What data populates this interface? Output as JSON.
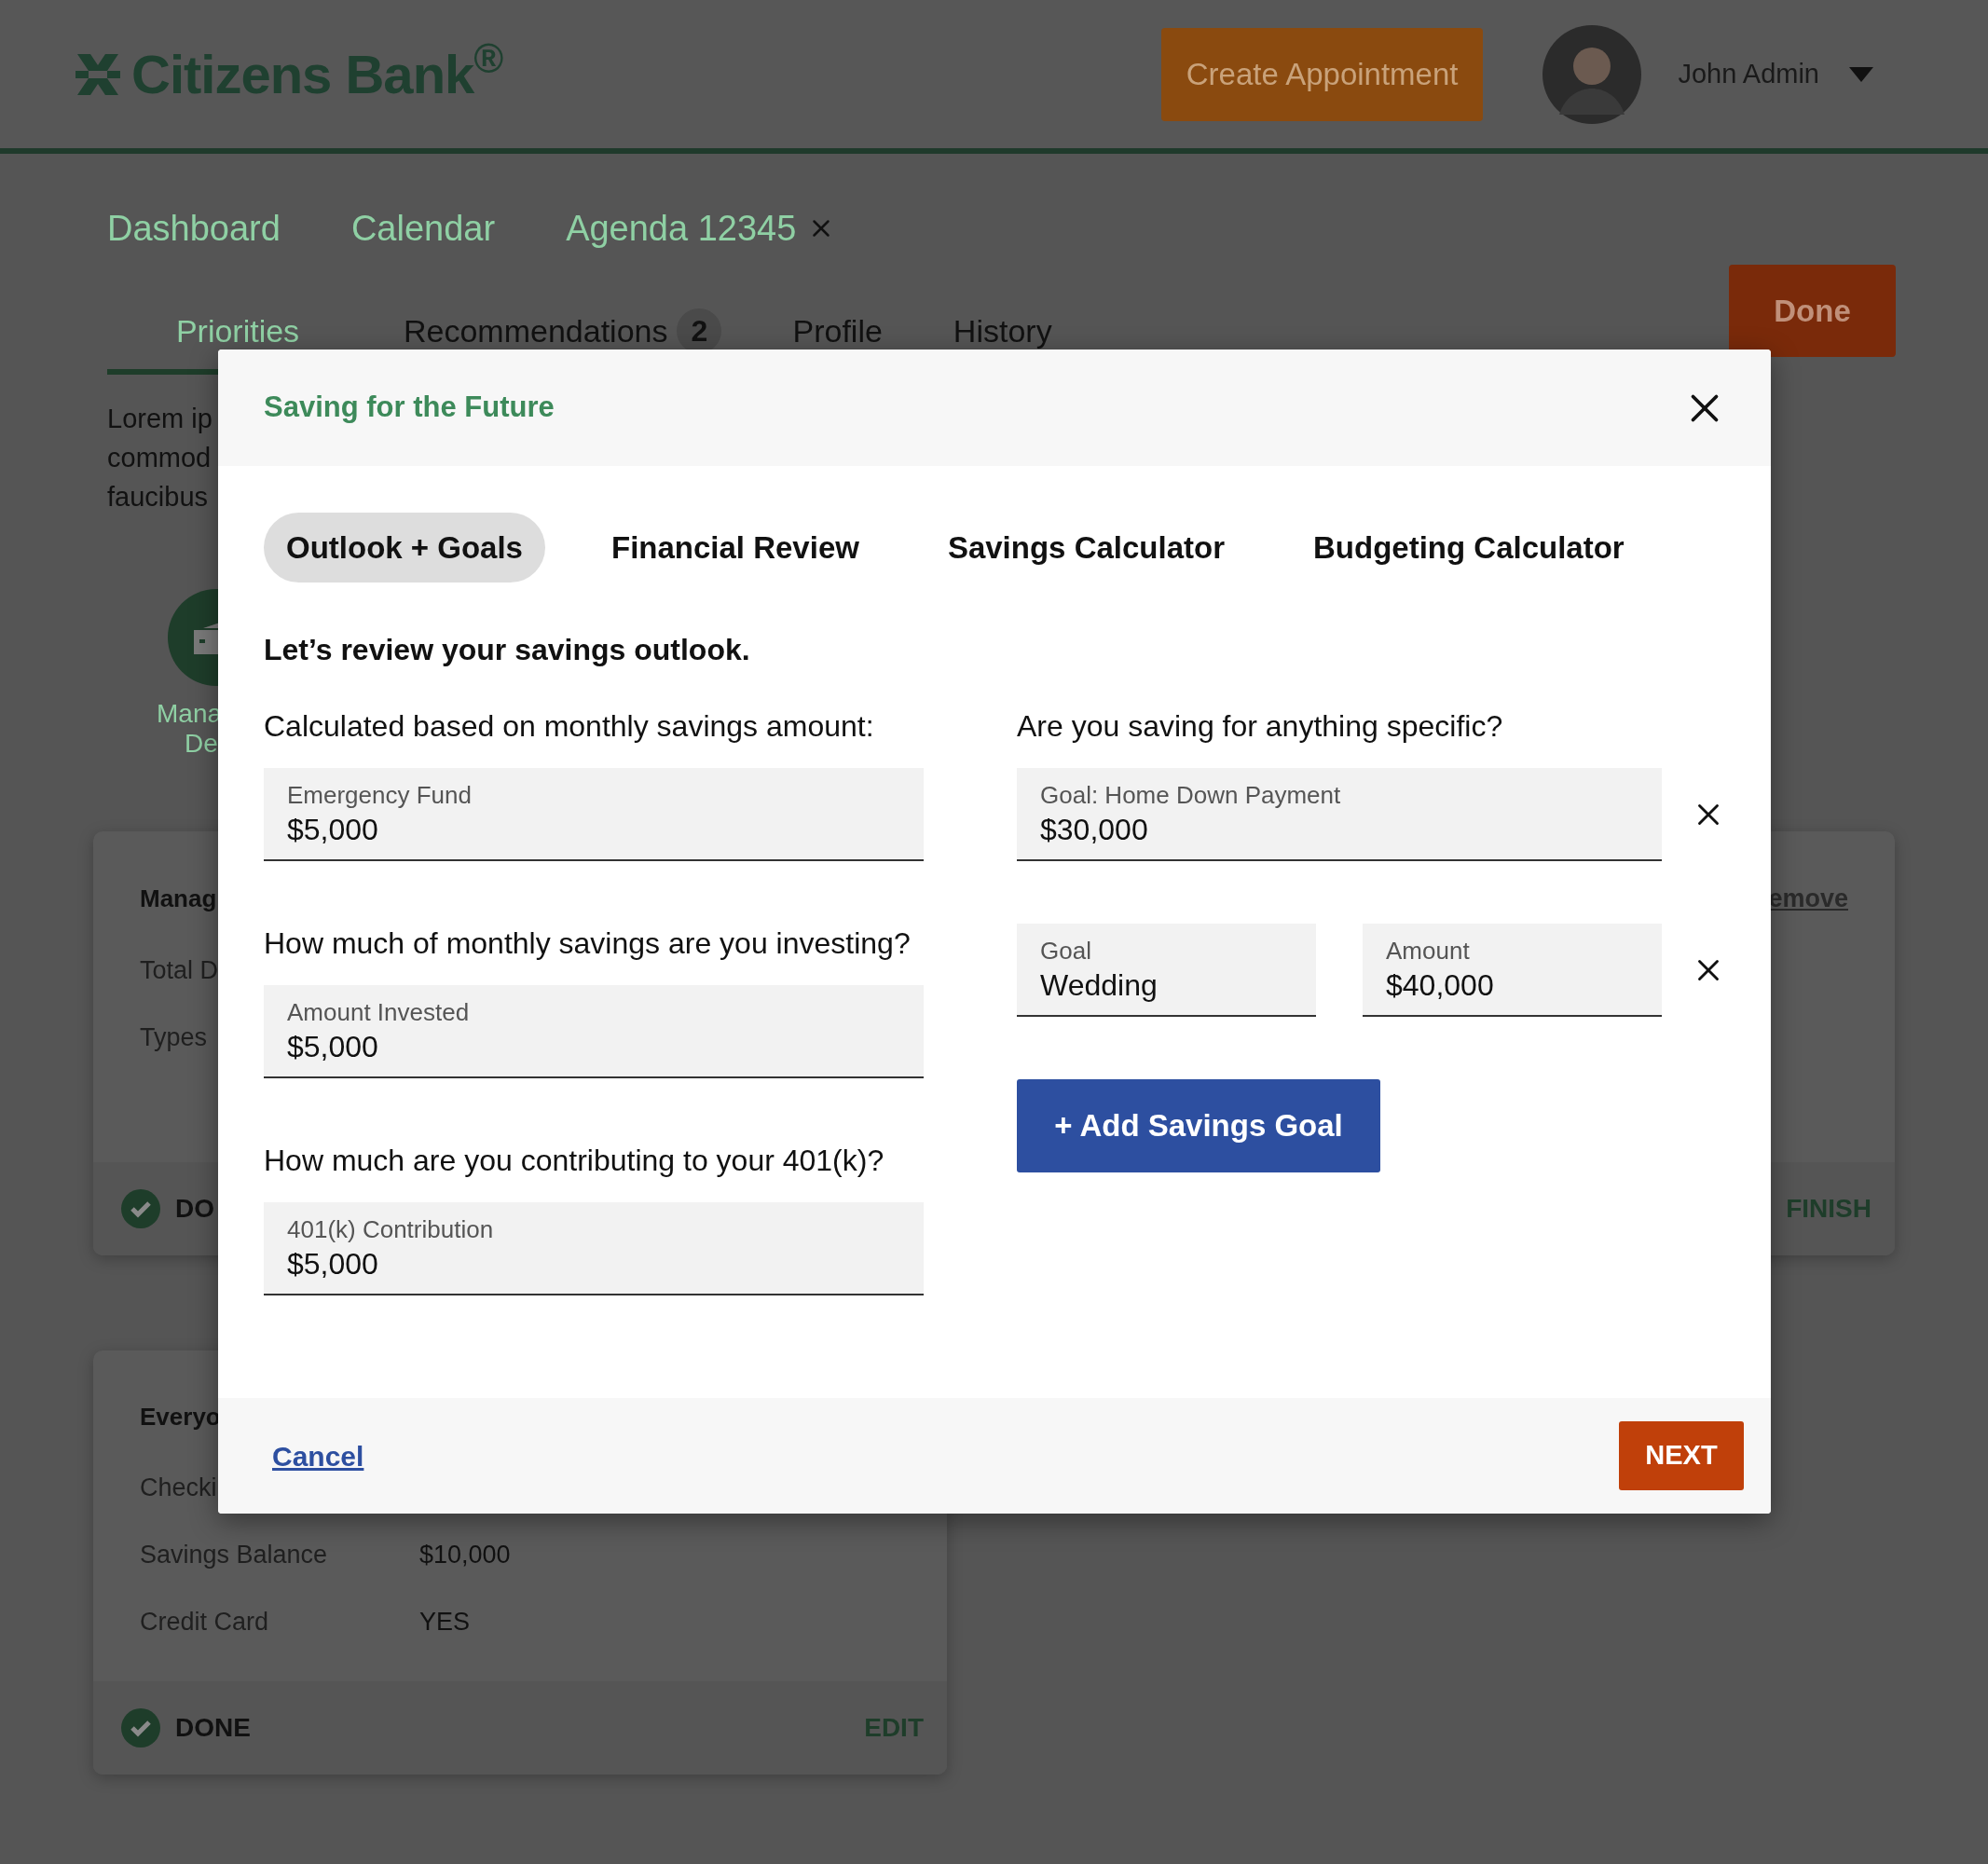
{
  "header": {
    "logo": "Citizens Bank$^{®}$",
    "create_button": "Create Appointment",
    "user": "John Admin"
  },
  "nav_links": [
    {
      "label": "Dashboard",
      "closable": false
    },
    {
      "label": "Calendar",
      "closable": false
    },
    {
      "label": "Agenda 12345",
      "closable": true
    }
  ],
  "tabs": [
    {
      "label": "Priorities",
      "selected": true
    },
    {
      "label": "Recommendations",
      "selected": false,
      "badge": "2"
    },
    {
      "label": "Profile",
      "selected": false
    },
    {
      "label": "History",
      "selected": false
    }
  ],
  "done_button": "Done",
  "intro_lines": [
    "Lorem ip",
    "commod",
    "faucibus"
  ],
  "feature_label": [
    "Mana",
    "De"
  ],
  "cards": [
    {
      "title": "Manag",
      "link": "emove",
      "rows": [
        {
          "label": "Total D"
        },
        {
          "label": "Types"
        }
      ],
      "status": "DO",
      "action": "FINISH"
    },
    {
      "title": "Everyo",
      "rows": [
        {
          "label": "Checki"
        },
        {
          "label": "Savings Balance",
          "value": "$10,000"
        },
        {
          "label": "Credit Card",
          "value": "YES"
        }
      ],
      "status": "DONE",
      "action": "EDIT"
    }
  ],
  "modal": {
    "title": "Saving for the Future",
    "tabs": [
      {
        "label": "Outlook + Goals",
        "selected": true
      },
      {
        "label": "Financial Review",
        "selected": false
      },
      {
        "label": "Savings Calculator",
        "selected": false
      },
      {
        "label": "Budgeting Calculator",
        "selected": false
      }
    ],
    "heading": "Let’s review your savings outlook.",
    "questions": [
      {
        "question": "Calculated based on monthly savings amount:",
        "field": {
          "label": "Emergency Fund",
          "value": "$5,000"
        }
      },
      {
        "question": "How much of monthly savings are you investing?",
        "field": {
          "label": "Amount Invested",
          "value": "$5,000"
        }
      },
      {
        "question": "How much are you contributing to your 401(k)?",
        "field": {
          "label": "401(k) Contribution",
          "value": "$5,000"
        }
      }
    ],
    "goals_question": "Are you saving for anything specific?",
    "goals": [
      {
        "fields": [
          {
            "label": "Goal: Home Down Payment",
            "value": "$30,000"
          }
        ]
      },
      {
        "fields": [
          {
            "label": "Goal",
            "value": "Wedding"
          },
          {
            "label": "Amount",
            "value": "$40,000"
          }
        ]
      }
    ],
    "add_button": "+ Add Savings Goal",
    "cancel": "Cancel",
    "next": "NEXT"
  }
}
